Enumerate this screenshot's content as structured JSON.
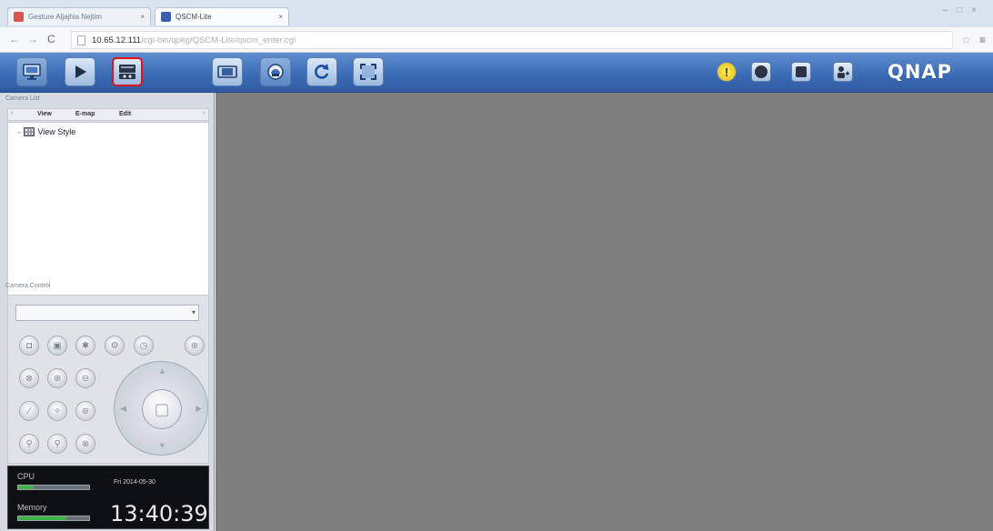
{
  "browser": {
    "tabs": [
      {
        "title": "Gesture Aljajhia Nejtim",
        "active": false
      },
      {
        "title": "QSCM-Lite",
        "active": true
      }
    ],
    "url_host": "10.65.12.111",
    "url_path": "/cgi-bin/qpkg/QSCM-Lite/qscm_enter.cgi"
  },
  "toolbar": {
    "left_buttons": [
      {
        "name": "monitor-icon",
        "selected": true
      },
      {
        "name": "playback-icon",
        "selected": false
      },
      {
        "name": "recording-settings-icon",
        "selected": false,
        "highlighted": true
      }
    ],
    "view_buttons": [
      "window-layout-icon",
      "sequence-icon",
      "refresh-icon",
      "fullscreen-icon"
    ],
    "status_icons": [
      "alert-icon",
      "record-icon",
      "message-icon",
      "user-icon"
    ],
    "logo": "QNAP",
    "accent": "#3c6cb6",
    "highlight_color": "#e0141b"
  },
  "left_panel": {
    "camera_list_header": "Camera List",
    "tabs": [
      "View",
      "E-map",
      "Edit"
    ],
    "tree": [
      {
        "label": "View Style"
      }
    ],
    "camera_control_header": "Camera Control",
    "selected_camera": ""
  },
  "status": {
    "cpu_label": "CPU",
    "cpu_level": 0.22,
    "memory_label": "Memory",
    "memory_level": 0.68,
    "date": "Fri 2014-05-30",
    "time": "13:40:39"
  }
}
